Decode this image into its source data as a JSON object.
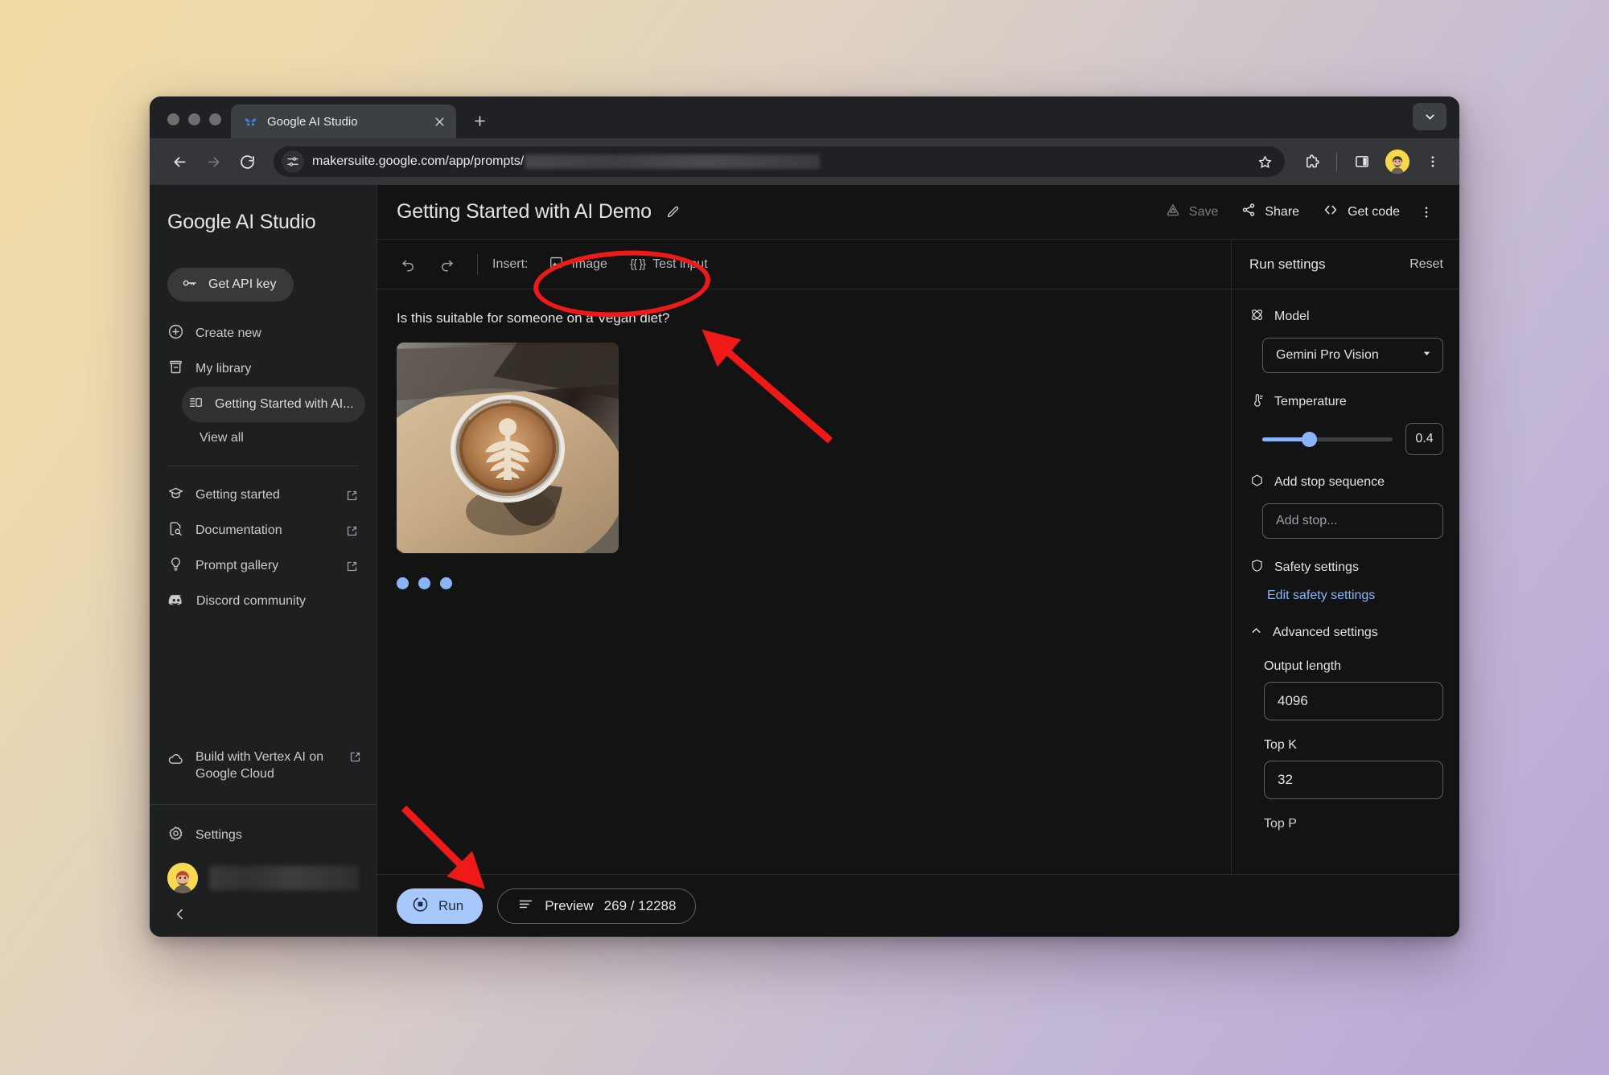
{
  "browser": {
    "tab": {
      "title": "Google AI Studio",
      "favicon": "google-ai-studio-logo"
    },
    "new_tab_label": "+",
    "omnibox": {
      "url": "makersuite.google.com/app/prompts/",
      "redacted": true
    },
    "controls": {
      "back": "back-arrow",
      "forward": "forward-arrow",
      "reload": "reload",
      "bookmark": "star-icon",
      "extensions": "extensions-icon",
      "side_panel": "side-panel-icon",
      "profile": "profile-avatar",
      "menu": "three-dot-menu",
      "window_chevron": "chevron-down-icon"
    }
  },
  "sidebar": {
    "brand": "Google AI Studio",
    "api_key_button": "Get API key",
    "items": [
      {
        "label": "Create new",
        "icon": "plus-circle-icon",
        "external": false
      },
      {
        "label": "My library",
        "icon": "library-icon",
        "external": false
      }
    ],
    "library_item": "Getting Started with AI...",
    "view_all": "View all",
    "links": [
      {
        "label": "Getting started",
        "icon": "graduation-cap-icon",
        "external": true
      },
      {
        "label": "Documentation",
        "icon": "doc-search-icon",
        "external": true
      },
      {
        "label": "Prompt gallery",
        "icon": "lightbulb-icon",
        "external": true
      },
      {
        "label": "Discord community",
        "icon": "discord-icon",
        "external": true
      }
    ],
    "vertex": {
      "label": "Build with Vertex AI on Google Cloud",
      "icon": "cloud-icon",
      "external": true
    },
    "settings": {
      "label": "Settings",
      "icon": "gear-icon"
    },
    "account": {
      "name_redacted": true,
      "avatar": "memoji-avatar"
    },
    "collapse": "chevron-left-icon"
  },
  "header": {
    "title": "Getting Started with AI Demo",
    "edit_icon": "pencil-icon",
    "save_label": "Save",
    "share_label": "Share",
    "get_code_label": "Get code",
    "more_icon": "three-dot-menu-icon"
  },
  "insert_bar": {
    "undo_icon": "undo-icon",
    "redo_icon": "redo-icon",
    "insert_label": "Insert:",
    "image_label": "Image",
    "image_icon": "image-icon",
    "braces": "{{ }}",
    "test_input_label": "Test input"
  },
  "editor": {
    "prompt_text": "Is this suitable for someone on a Vegan diet?",
    "image_alt": "latte-art-coffee-cup-on-wooden-table",
    "loading_dots": 3
  },
  "run_settings": {
    "title": "Run settings",
    "reset_label": "Reset",
    "model": {
      "label": "Model",
      "icon": "model-atom-icon",
      "value": "Gemini Pro Vision",
      "chevron": "chevron-down-icon"
    },
    "temperature": {
      "label": "Temperature",
      "icon": "thermometer-icon",
      "value": "0.4",
      "fill_percent": 36
    },
    "stop_sequence": {
      "label": "Add stop sequence",
      "icon": "hexagon-icon",
      "placeholder": "Add stop..."
    },
    "safety": {
      "label": "Safety settings",
      "icon": "shield-icon",
      "edit_link": "Edit safety settings"
    },
    "advanced": {
      "label": "Advanced settings",
      "icon": "chevron-up-icon"
    },
    "output_length": {
      "label": "Output length",
      "value": "4096"
    },
    "top_k": {
      "label": "Top K",
      "value": "32"
    },
    "top_p_peek": "Top P"
  },
  "bottom_bar": {
    "run_label": "Run",
    "run_icon": "run-stop-icon",
    "preview_label": "Preview",
    "preview_icon": "lines-icon",
    "token_count": "269 / 12288"
  },
  "annotations": {
    "ellipse_target": "insert-image-controls",
    "arrow_1_target": "prompt-image",
    "arrow_2_target": "run-button",
    "color": "#ef1a17"
  },
  "colors": {
    "accent_blue": "#8ab4f8",
    "run_button": "#a8c7fa",
    "app_bg": "#131314",
    "sidebar_bg": "#1e1f20",
    "annotation_red": "#ef1a17"
  }
}
